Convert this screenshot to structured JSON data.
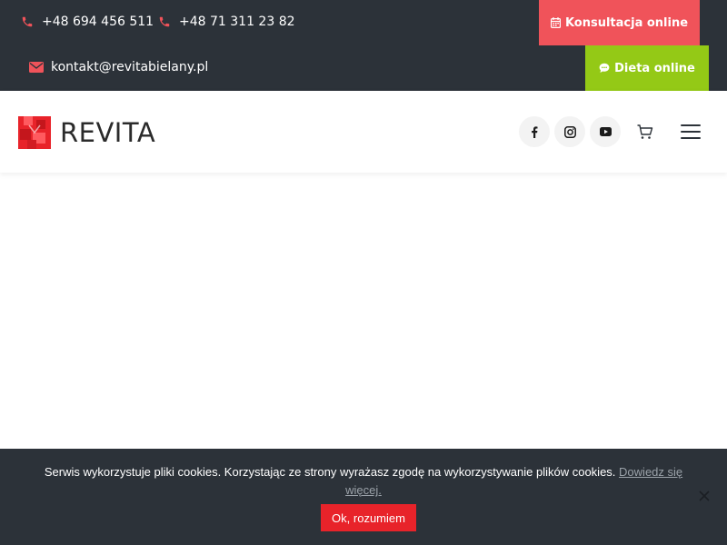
{
  "topbar": {
    "phone1": "+48 694 456 511",
    "phone2": "+48 71 311 23 82",
    "email": "kontakt@revitabielany.pl",
    "consult_label": "Konsultacja online",
    "diet_label": "Dieta online",
    "colors": {
      "background": "#2c3239",
      "consult": "#f0535a",
      "diet": "#94c916",
      "icon_accent": "#f0535a"
    }
  },
  "header": {
    "logo_text": "REVITA",
    "logo_color": "#e8232a",
    "social": [
      {
        "name": "facebook-icon"
      },
      {
        "name": "instagram-icon"
      },
      {
        "name": "youtube-icon"
      }
    ],
    "cart_icon": "cart-icon",
    "menu_icon": "hamburger-menu-icon"
  },
  "cookie": {
    "text": "Serwis wykorzystuje pliki cookies. Korzystając ze strony wyrażasz zgodę na wykorzystywanie plików cookies.",
    "link": "Dowiedz się więcej.",
    "ok_label": "Ok, rozumiem",
    "close_icon": "close-icon",
    "colors": {
      "background": "#2c3239",
      "button": "#e8232a"
    }
  }
}
